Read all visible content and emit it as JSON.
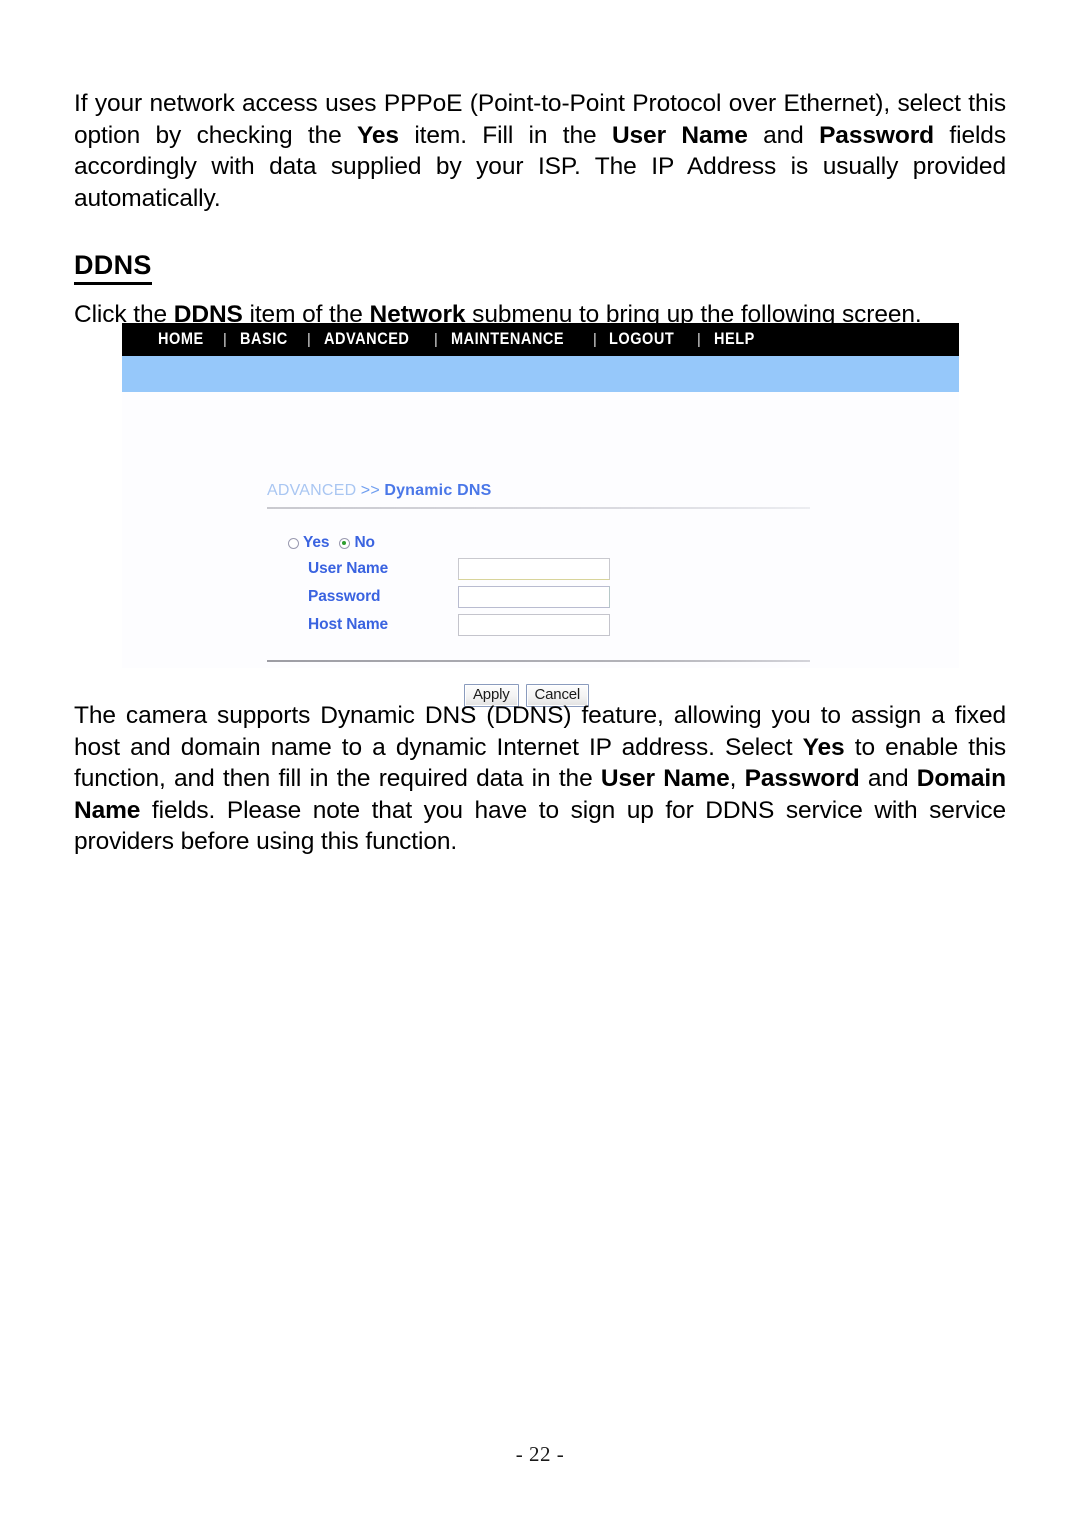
{
  "document": {
    "paragraph_1": {
      "segments": [
        {
          "text": "If your network access uses PPPoE (Point-to-Point Protocol over Ethernet), select this option by checking the ",
          "bold": false
        },
        {
          "text": "Yes",
          "bold": true
        },
        {
          "text": " item.  Fill in the ",
          "bold": false
        },
        {
          "text": "User Name",
          "bold": true
        },
        {
          "text": " and ",
          "bold": false
        },
        {
          "text": "Password",
          "bold": true
        },
        {
          "text": " fields accordingly with data supplied by your ISP.  The IP Address is usually provided automatically.",
          "bold": false
        }
      ]
    },
    "section_heading": "DDNS",
    "click_line": {
      "segments": [
        {
          "text": "Click the ",
          "bold": false
        },
        {
          "text": "DDNS",
          "bold": true
        },
        {
          "text": " item of the ",
          "bold": false
        },
        {
          "text": "Network",
          "bold": true
        },
        {
          "text": " submenu to bring up the following screen.",
          "bold": false
        }
      ]
    },
    "paragraph_2": {
      "segments": [
        {
          "text": "The camera supports Dynamic DNS (DDNS) feature, allowing you to assign a fixed host and domain name to a dynamic Internet IP address.  Select ",
          "bold": false
        },
        {
          "text": "Yes",
          "bold": true
        },
        {
          "text": " to enable this function, and then fill in the required data in the ",
          "bold": false
        },
        {
          "text": "User Name",
          "bold": true
        },
        {
          "text": ", ",
          "bold": false
        },
        {
          "text": "Password",
          "bold": true
        },
        {
          "text": " and ",
          "bold": false
        },
        {
          "text": "Domain Name",
          "bold": true
        },
        {
          "text": " fields.  Please note that you have to sign up for DDNS service with service providers before using this function.",
          "bold": false
        }
      ]
    },
    "page_number": "- 22 -"
  },
  "screenshot": {
    "nav": {
      "separator": "|",
      "items": [
        {
          "label": "HOME"
        },
        {
          "label": "BASIC"
        },
        {
          "label": "ADVANCED"
        },
        {
          "label": "MAINTENANCE"
        },
        {
          "label": "LOGOUT"
        },
        {
          "label": "HELP"
        }
      ]
    },
    "breadcrumb": {
      "parent": "ADVANCED",
      "arrows": ">>",
      "current": "Dynamic DNS"
    },
    "form": {
      "radios": [
        {
          "label": "Yes",
          "selected": false
        },
        {
          "label": "No",
          "selected": true
        }
      ],
      "fields": [
        {
          "label": "User Name",
          "value": "",
          "placeholder": ""
        },
        {
          "label": "Password",
          "value": "",
          "placeholder": ""
        },
        {
          "label": "Host Name",
          "value": "",
          "placeholder": ""
        }
      ],
      "buttons": [
        {
          "label": "Apply"
        },
        {
          "label": "Cancel"
        }
      ]
    },
    "colors": {
      "nav_background": "#000000",
      "nav_text": "#ffffff",
      "band": "#96c8fa",
      "label_blue": "#3a63e0",
      "breadcrumb_current": "#4a77e8",
      "radio_selected_dot": "#2f9e2f"
    }
  }
}
